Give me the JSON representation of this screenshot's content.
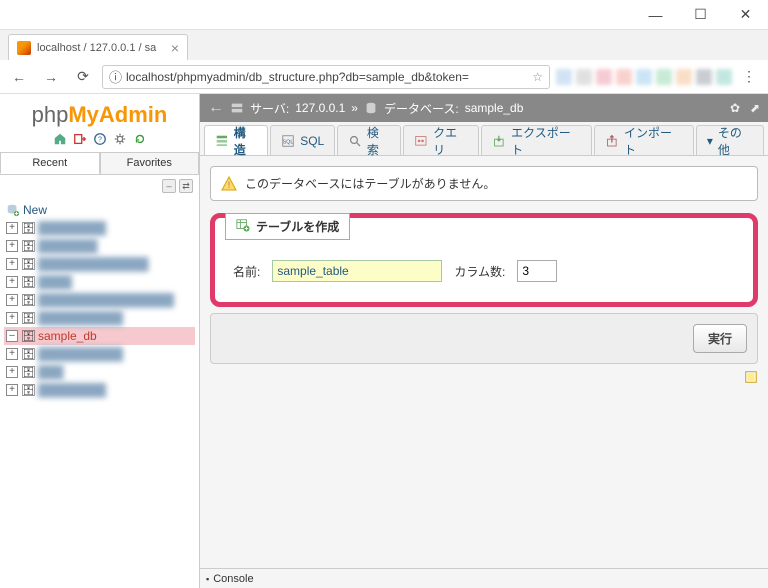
{
  "window": {
    "tab_title": "localhost / 127.0.0.1 / sa",
    "url": "localhost/phpmyadmin/db_structure.php?db=sample_db&token="
  },
  "sidebar": {
    "logo_php": "php",
    "logo_my": "My",
    "logo_admin": "Admin",
    "tabs": {
      "recent": "Recent",
      "favorites": "Favorites"
    },
    "new_label": "New",
    "selected_db": "sample_db"
  },
  "breadcrumb": {
    "server_label": "サーバ:",
    "server_value": "127.0.0.1",
    "db_label": "データベース:",
    "db_value": "sample_db"
  },
  "tabs": {
    "structure": "構造",
    "sql": "SQL",
    "search": "検索",
    "query": "クエリ",
    "export": "エクスポート",
    "import": "インポート",
    "more": "その他"
  },
  "notice": {
    "text": "このデータベースにはテーブルがありません。"
  },
  "create_table": {
    "legend": "テーブルを作成",
    "name_label": "名前:",
    "name_value": "sample_table",
    "columns_label": "カラム数:",
    "columns_value": "3"
  },
  "actions": {
    "execute": "実行"
  },
  "console": {
    "label": "Console"
  }
}
